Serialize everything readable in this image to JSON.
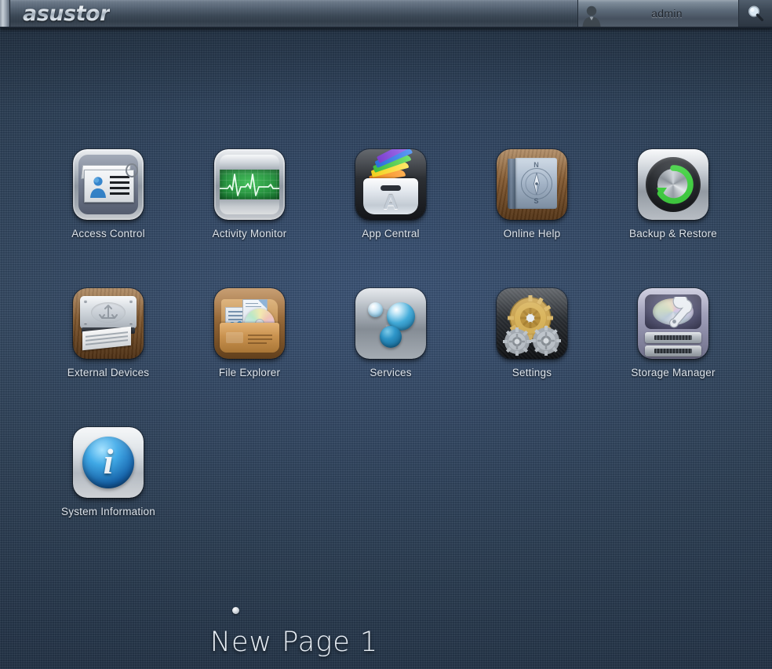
{
  "topbar": {
    "brand": "asustor",
    "user_name": "admin",
    "avatar_icon": "user-avatar-icon",
    "search_icon": "search-icon"
  },
  "desktop": {
    "background_color": "#2d415a",
    "label_color": "#dde4ec",
    "apps": [
      {
        "id": "access-control",
        "label": "Access Control",
        "icon": "id-card-icon"
      },
      {
        "id": "activity-monitor",
        "label": "Activity Monitor",
        "icon": "heartbeat-monitor-icon"
      },
      {
        "id": "app-central",
        "label": "App Central",
        "icon": "app-basket-icon"
      },
      {
        "id": "online-help",
        "label": "Online Help",
        "icon": "book-compass-icon"
      },
      {
        "id": "backup-restore",
        "label": "Backup & Restore",
        "icon": "refresh-circle-icon"
      },
      {
        "id": "external-devices",
        "label": "External Devices",
        "icon": "printer-icon"
      },
      {
        "id": "file-explorer",
        "label": "File Explorer",
        "icon": "folder-disc-icon"
      },
      {
        "id": "services",
        "label": "Services",
        "icon": "network-nodes-icon"
      },
      {
        "id": "settings",
        "label": "Settings",
        "icon": "gears-icon"
      },
      {
        "id": "storage-manager",
        "label": "Storage Manager",
        "icon": "disk-wrench-icon"
      },
      {
        "id": "system-information",
        "label": "System Information",
        "icon": "info-circle-icon"
      }
    ]
  },
  "pager": {
    "dots": [
      {
        "active": true
      }
    ],
    "page_title": "New Page 1"
  },
  "compass": {
    "north": "N",
    "south": "S"
  },
  "app_central": {
    "letter": "A"
  },
  "system_information": {
    "glyph": "i"
  }
}
